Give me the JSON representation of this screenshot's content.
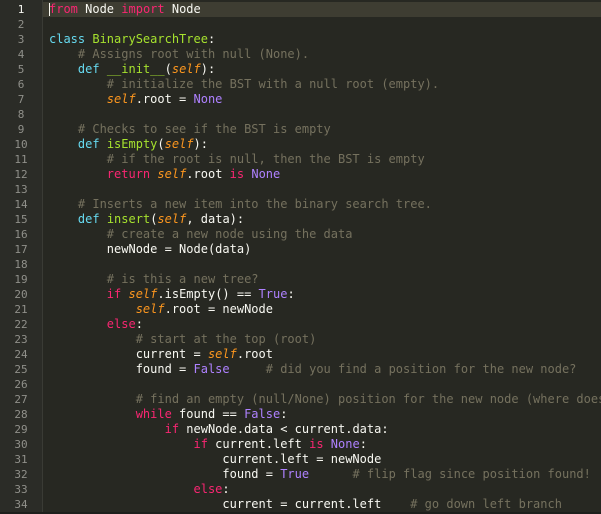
{
  "editor": {
    "active_line": 1,
    "lines": [
      {
        "num": "1",
        "tokens": [
          {
            "t": "from",
            "c": "kw"
          },
          {
            "t": " Node ",
            "c": "tx"
          },
          {
            "t": "import",
            "c": "kw"
          },
          {
            "t": " Node",
            "c": "tx"
          }
        ]
      },
      {
        "num": "2",
        "tokens": []
      },
      {
        "num": "3",
        "tokens": [
          {
            "t": "class",
            "c": "def"
          },
          {
            "t": " ",
            "c": "tx"
          },
          {
            "t": "BinarySearchTree",
            "c": "fn"
          },
          {
            "t": ":",
            "c": "tx"
          }
        ]
      },
      {
        "num": "4",
        "tokens": [
          {
            "t": "    # Assigns root with null (None).",
            "c": "cm"
          }
        ]
      },
      {
        "num": "5",
        "tokens": [
          {
            "t": "    ",
            "c": "tx"
          },
          {
            "t": "def",
            "c": "def"
          },
          {
            "t": " ",
            "c": "tx"
          },
          {
            "t": "__init__",
            "c": "fn"
          },
          {
            "t": "(",
            "c": "tx"
          },
          {
            "t": "self",
            "c": "self"
          },
          {
            "t": "):",
            "c": "tx"
          }
        ]
      },
      {
        "num": "6",
        "tokens": [
          {
            "t": "        # initialize the BST with a null root (empty).",
            "c": "cm"
          }
        ]
      },
      {
        "num": "7",
        "tokens": [
          {
            "t": "        ",
            "c": "tx"
          },
          {
            "t": "self",
            "c": "self"
          },
          {
            "t": ".root = ",
            "c": "tx"
          },
          {
            "t": "None",
            "c": "const"
          }
        ]
      },
      {
        "num": "8",
        "tokens": []
      },
      {
        "num": "9",
        "tokens": [
          {
            "t": "    # Checks to see if the BST is empty",
            "c": "cm"
          }
        ]
      },
      {
        "num": "10",
        "tokens": [
          {
            "t": "    ",
            "c": "tx"
          },
          {
            "t": "def",
            "c": "def"
          },
          {
            "t": " ",
            "c": "tx"
          },
          {
            "t": "isEmpty",
            "c": "fn"
          },
          {
            "t": "(",
            "c": "tx"
          },
          {
            "t": "self",
            "c": "self"
          },
          {
            "t": "):",
            "c": "tx"
          }
        ]
      },
      {
        "num": "11",
        "tokens": [
          {
            "t": "        # if the root is null, then the BST is empty",
            "c": "cm"
          }
        ]
      },
      {
        "num": "12",
        "tokens": [
          {
            "t": "        ",
            "c": "tx"
          },
          {
            "t": "return",
            "c": "kw"
          },
          {
            "t": " ",
            "c": "tx"
          },
          {
            "t": "self",
            "c": "self"
          },
          {
            "t": ".root ",
            "c": "tx"
          },
          {
            "t": "is",
            "c": "kw"
          },
          {
            "t": " ",
            "c": "tx"
          },
          {
            "t": "None",
            "c": "const"
          }
        ]
      },
      {
        "num": "13",
        "tokens": []
      },
      {
        "num": "14",
        "tokens": [
          {
            "t": "    # Inserts a new item into the binary search tree.",
            "c": "cm"
          }
        ]
      },
      {
        "num": "15",
        "tokens": [
          {
            "t": "    ",
            "c": "tx"
          },
          {
            "t": "def",
            "c": "def"
          },
          {
            "t": " ",
            "c": "tx"
          },
          {
            "t": "insert",
            "c": "fn"
          },
          {
            "t": "(",
            "c": "tx"
          },
          {
            "t": "self",
            "c": "self"
          },
          {
            "t": ", data):",
            "c": "tx"
          }
        ]
      },
      {
        "num": "16",
        "tokens": [
          {
            "t": "        # create a new node using the data",
            "c": "cm"
          }
        ]
      },
      {
        "num": "17",
        "tokens": [
          {
            "t": "        newNode = Node(data)",
            "c": "tx"
          }
        ]
      },
      {
        "num": "18",
        "tokens": []
      },
      {
        "num": "19",
        "tokens": [
          {
            "t": "        # is this a new tree?",
            "c": "cm"
          }
        ]
      },
      {
        "num": "20",
        "tokens": [
          {
            "t": "        ",
            "c": "tx"
          },
          {
            "t": "if",
            "c": "kw"
          },
          {
            "t": " ",
            "c": "tx"
          },
          {
            "t": "self",
            "c": "self"
          },
          {
            "t": ".isEmpty() == ",
            "c": "tx"
          },
          {
            "t": "True",
            "c": "const"
          },
          {
            "t": ":",
            "c": "tx"
          }
        ]
      },
      {
        "num": "21",
        "tokens": [
          {
            "t": "            ",
            "c": "tx"
          },
          {
            "t": "self",
            "c": "self"
          },
          {
            "t": ".root = newNode",
            "c": "tx"
          }
        ]
      },
      {
        "num": "22",
        "tokens": [
          {
            "t": "        ",
            "c": "tx"
          },
          {
            "t": "else",
            "c": "kw"
          },
          {
            "t": ":",
            "c": "tx"
          }
        ]
      },
      {
        "num": "23",
        "tokens": [
          {
            "t": "            # start at the top (root)",
            "c": "cm"
          }
        ]
      },
      {
        "num": "24",
        "tokens": [
          {
            "t": "            current = ",
            "c": "tx"
          },
          {
            "t": "self",
            "c": "self"
          },
          {
            "t": ".root",
            "c": "tx"
          }
        ]
      },
      {
        "num": "25",
        "tokens": [
          {
            "t": "            found = ",
            "c": "tx"
          },
          {
            "t": "False",
            "c": "const"
          },
          {
            "t": "     ",
            "c": "tx"
          },
          {
            "t": "# did you find a position for the new node?",
            "c": "cm"
          }
        ]
      },
      {
        "num": "26",
        "tokens": []
      },
      {
        "num": "27",
        "tokens": [
          {
            "t": "            # find an empty (null/None) position for the new node (where does i",
            "c": "cm"
          }
        ]
      },
      {
        "num": "28",
        "tokens": [
          {
            "t": "            ",
            "c": "tx"
          },
          {
            "t": "while",
            "c": "kw"
          },
          {
            "t": " found == ",
            "c": "tx"
          },
          {
            "t": "False",
            "c": "const"
          },
          {
            "t": ":",
            "c": "tx"
          }
        ]
      },
      {
        "num": "29",
        "tokens": [
          {
            "t": "                ",
            "c": "tx"
          },
          {
            "t": "if",
            "c": "kw"
          },
          {
            "t": " newNode.data < current.data:",
            "c": "tx"
          }
        ]
      },
      {
        "num": "30",
        "tokens": [
          {
            "t": "                    ",
            "c": "tx"
          },
          {
            "t": "if",
            "c": "kw"
          },
          {
            "t": " current.left ",
            "c": "tx"
          },
          {
            "t": "is",
            "c": "kw"
          },
          {
            "t": " ",
            "c": "tx"
          },
          {
            "t": "None",
            "c": "const"
          },
          {
            "t": ":",
            "c": "tx"
          }
        ]
      },
      {
        "num": "31",
        "tokens": [
          {
            "t": "                        current.left = newNode",
            "c": "tx"
          }
        ]
      },
      {
        "num": "32",
        "tokens": [
          {
            "t": "                        found = ",
            "c": "tx"
          },
          {
            "t": "True",
            "c": "const"
          },
          {
            "t": "      ",
            "c": "tx"
          },
          {
            "t": "# flip flag since position found!",
            "c": "cm"
          }
        ]
      },
      {
        "num": "33",
        "tokens": [
          {
            "t": "                    ",
            "c": "tx"
          },
          {
            "t": "else",
            "c": "kw"
          },
          {
            "t": ":",
            "c": "tx"
          }
        ]
      },
      {
        "num": "34",
        "tokens": [
          {
            "t": "                        current = current.left    ",
            "c": "tx"
          },
          {
            "t": "# go down left branch",
            "c": "cm"
          }
        ]
      }
    ]
  }
}
